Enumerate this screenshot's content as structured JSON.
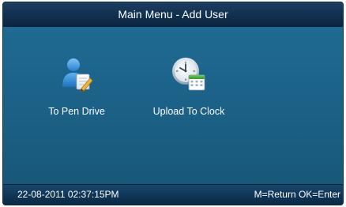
{
  "titlebar": {
    "title": "Main Menu - Add User"
  },
  "menu": {
    "items": [
      {
        "label": "To Pen Drive",
        "icon": "user-edit-icon"
      },
      {
        "label": "Upload To Clock",
        "icon": "clock-calendar-icon"
      }
    ]
  },
  "statusbar": {
    "datetime": "22-08-2011  02:37:15PM",
    "help": "M=Return OK=Enter"
  },
  "colors": {
    "background": "#1c5f84",
    "titlebar": "#10304f",
    "statusbar": "#0f3557",
    "text": "#ffffff"
  }
}
